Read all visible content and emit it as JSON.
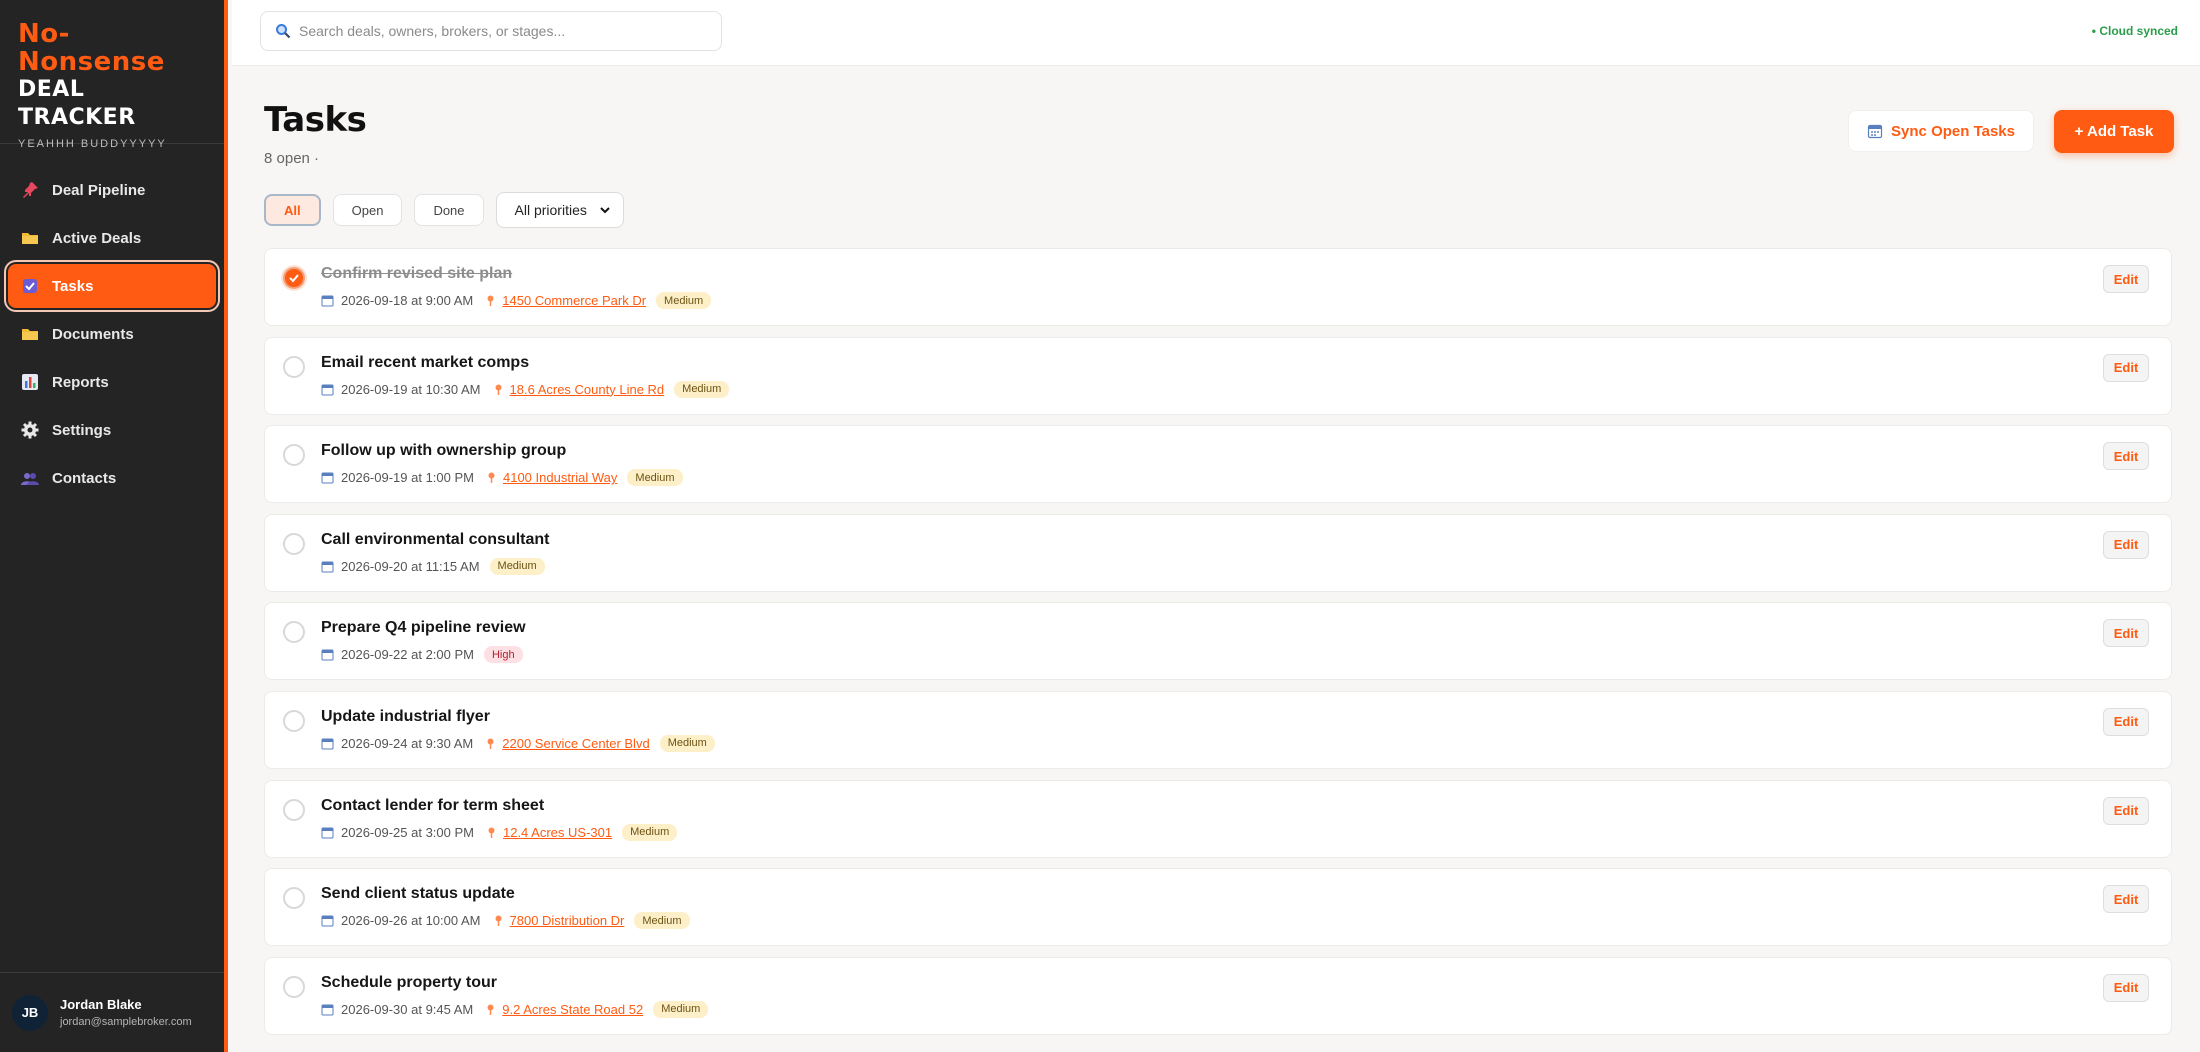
{
  "brand": {
    "line1a": "No-",
    "line1b": "Nonsense",
    "line2": "DEAL TRACKER",
    "tagline": "YEAHHH BUDDYYYYY"
  },
  "colors": {
    "accent": "#ff5b12",
    "sidebar_bg": "#242424",
    "synced": "#2a9d4b"
  },
  "sidebar": {
    "items": [
      {
        "label": "Deal Pipeline",
        "icon": "pushpin-icon"
      },
      {
        "label": "Active Deals",
        "icon": "folder-icon"
      },
      {
        "label": "Tasks",
        "icon": "checkbox-icon",
        "active": true
      },
      {
        "label": "Documents",
        "icon": "folder-icon"
      },
      {
        "label": "Reports",
        "icon": "bar-chart-icon"
      },
      {
        "label": "Settings",
        "icon": "gear-icon"
      },
      {
        "label": "Contacts",
        "icon": "people-icon"
      }
    ]
  },
  "user": {
    "initials": "JB",
    "name": "Jordan Blake",
    "email": "jordan@samplebroker.com"
  },
  "search": {
    "placeholder": "Search deals, owners, brokers, or stages..."
  },
  "status": {
    "sync_text": "• Cloud synced"
  },
  "page": {
    "title": "Tasks",
    "subtitle": "8 open ·"
  },
  "actions": {
    "sync_label": "Sync Open Tasks",
    "add_label": "+ Add Task"
  },
  "filters": {
    "all": "All",
    "open": "Open",
    "done": "Done",
    "priority_selected": "All priorities"
  },
  "edit_label": "Edit",
  "tasks": [
    {
      "title": "Confirm revised site plan",
      "when": "2026-09-18 at 9:00 AM",
      "deal": "1450 Commerce Park Dr",
      "priority": "Medium",
      "done": true
    },
    {
      "title": "Email recent market comps",
      "when": "2026-09-19 at 10:30 AM",
      "deal": "18.6 Acres County Line Rd",
      "priority": "Medium",
      "done": false
    },
    {
      "title": "Follow up with ownership group",
      "when": "2026-09-19 at 1:00 PM",
      "deal": "4100 Industrial Way",
      "priority": "Medium",
      "done": false
    },
    {
      "title": "Call environmental consultant",
      "when": "2026-09-20 at 11:15 AM",
      "deal": "",
      "priority": "Medium",
      "done": false
    },
    {
      "title": "Prepare Q4 pipeline review",
      "when": "2026-09-22 at 2:00 PM",
      "deal": "",
      "priority": "High",
      "done": false
    },
    {
      "title": "Update industrial flyer",
      "when": "2026-09-24 at 9:30 AM",
      "deal": "2200 Service Center Blvd",
      "priority": "Medium",
      "done": false
    },
    {
      "title": "Contact lender for term sheet",
      "when": "2026-09-25 at 3:00 PM",
      "deal": "12.4 Acres US-301",
      "priority": "Medium",
      "done": false
    },
    {
      "title": "Send client status update",
      "when": "2026-09-26 at 10:00 AM",
      "deal": "7800 Distribution Dr",
      "priority": "Medium",
      "done": false
    },
    {
      "title": "Schedule property tour",
      "when": "2026-09-30 at 9:45 AM",
      "deal": "9.2 Acres State Road 52",
      "priority": "Medium",
      "done": false
    }
  ]
}
